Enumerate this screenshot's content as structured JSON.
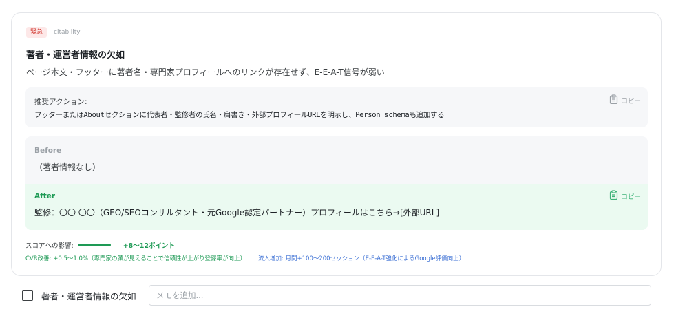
{
  "issue": {
    "priority_badge": "緊急",
    "category_tag": "citability",
    "title": "著者・運営者情報の欠如",
    "description": "ページ本文・フッターに著者名・専門家プロフィールへのリンクが存在せず、E-E-A-T信号が弱い"
  },
  "action": {
    "label": "推奨アクション:",
    "text": "フッターまたはAboutセクションに代表者・監修者の氏名・肩書き・外部プロフィールURLを明示し、Person schemaも追加する",
    "copy_label": "コピー"
  },
  "before": {
    "label": "Before",
    "text": "（著者情報なし）"
  },
  "after": {
    "label": "After",
    "text": "監修：〇〇 〇〇（GEO/SEOコンサルタント・元Google認定パートナー）プロフィールはこちら→[外部URL]",
    "copy_label": "コピー"
  },
  "score": {
    "label": "スコアへの影響:",
    "value_text": "+8〜12ポイント",
    "bar_fraction": 1.0,
    "bar_color": "#1e9a55"
  },
  "impact": {
    "cvr": "CVR改善: +0.5〜1.0%（専門家の顔が見えることで信頼性が上がり登録率が向上）",
    "traffic": "流入増加: 月間+100〜200セッション（E-E-A-T強化によるGoogle評価向上）"
  },
  "bottom": {
    "checkbox_label": "著者・運営者情報の欠如",
    "memo_placeholder": "メモを追加...",
    "memo_value": ""
  },
  "icons": {
    "copy": "clipboard-icon"
  },
  "colors": {
    "urgent": "#d0342c",
    "success": "#1e9a55",
    "link_blue": "#3b6fd4",
    "after_bg": "#ebfaf1"
  }
}
